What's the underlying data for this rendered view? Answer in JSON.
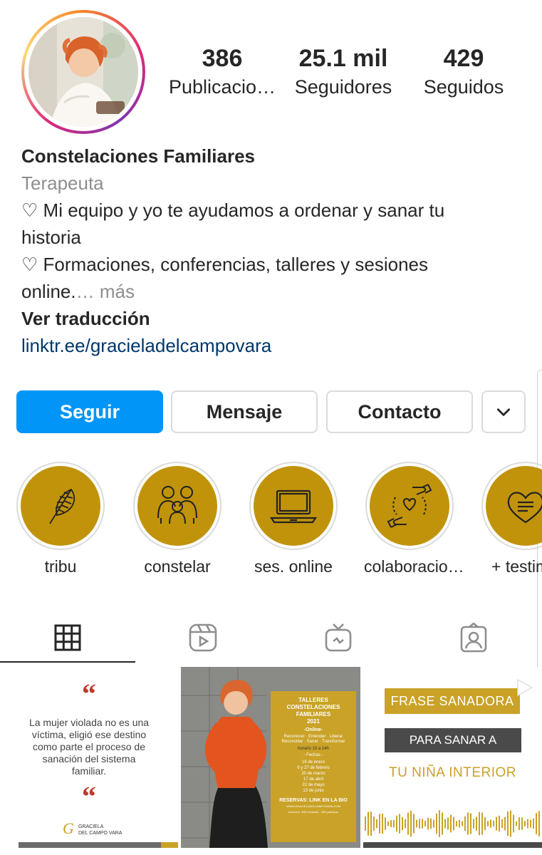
{
  "profile": {
    "stats": [
      {
        "value": "386",
        "label": "Publicacio…"
      },
      {
        "value": "25.1 mil",
        "label": "Seguidores"
      },
      {
        "value": "429",
        "label": "Seguidos"
      }
    ],
    "name": "Constelaciones Familiares",
    "category": "Terapeuta",
    "bio_line1": "♡ Mi equipo y yo te ayudamos a ordenar y sanar tu",
    "bio_line2": "historia",
    "bio_line3": "♡ Formaciones, conferencias, talleres y sesiones",
    "bio_line4": "online.",
    "bio_more": "… más",
    "see_translation": "Ver traducción",
    "link": "linktr.ee/gracieladelcampovara"
  },
  "actions": {
    "follow": "Seguir",
    "message": "Mensaje",
    "contact": "Contacto"
  },
  "highlights": [
    {
      "label": "tribu",
      "icon": "feather-icon"
    },
    {
      "label": "constelar",
      "icon": "family-icon"
    },
    {
      "label": "ses. online",
      "icon": "laptop-icon"
    },
    {
      "label": "colaboracio…",
      "icon": "hands-heart-icon"
    },
    {
      "label": "+ testim",
      "icon": "heart-chat-icon"
    }
  ],
  "tabs": [
    "grid-icon",
    "reels-icon",
    "igtv-icon",
    "tagged-icon"
  ],
  "posts": {
    "post1": {
      "quote_mark": "“",
      "text_lines": [
        "La mujer violada no es una",
        "víctima, eligió ese destino",
        "como parte el proceso de",
        "sanación del sistema",
        "familiar."
      ],
      "brand_line1": "GRACIELA",
      "brand_line2": "DEL CAMPO VARA"
    },
    "post2": {
      "title_lines": [
        "TALLERES",
        "CONSTELACIONES",
        "FAMILIARES",
        "2021"
      ],
      "online": "-Online-",
      "keywords_line1": "Reconocer · Entender · Liberar",
      "keywords_line2": "Reconciliar · Sanar · Transformar",
      "schedule": "horario 10 a 14h",
      "dates_label": "- Fechas -",
      "dates": [
        "16 de enero",
        "6 y 27 de febrero",
        "20 de marzo",
        "17 de abril",
        "22 de mayo",
        "13 de junio"
      ],
      "reservas": "RESERVAS: LINK EN LA BIO",
      "website": "WWW.GRACIELADELCAMPOVARA.COM",
      "price": "Inversión: 80€ constelar · 30€ participar"
    },
    "post3": {
      "line1": "FRASE SANADORA",
      "line2": "PARA SANAR A",
      "line3": "TU NIÑA INTERIOR"
    }
  },
  "colors": {
    "follow_blue": "#0095f6",
    "highlight_gold": "#c1930a",
    "link_blue": "#00376b",
    "muted_gray": "#8e8e8e"
  }
}
